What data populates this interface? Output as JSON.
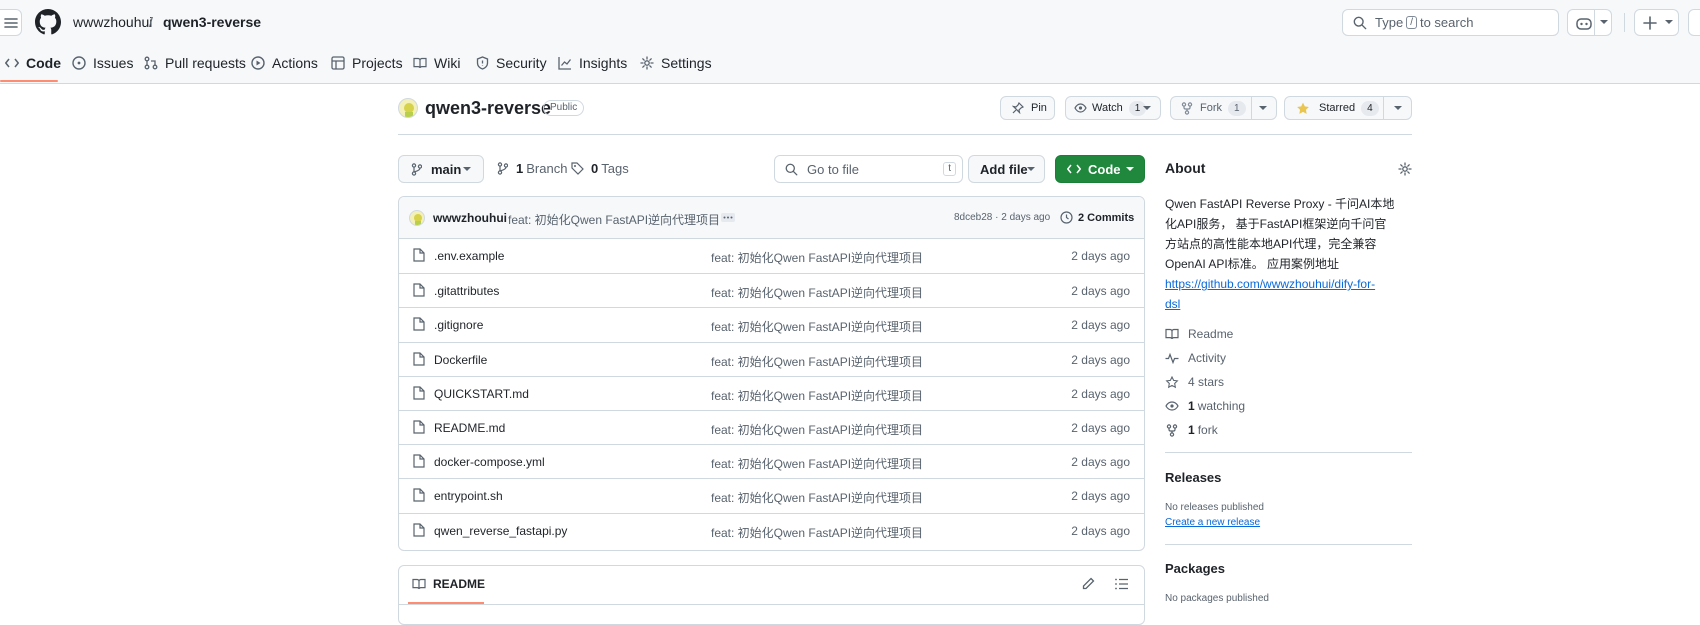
{
  "header": {
    "owner": "wwwzhouhui",
    "separator": "/",
    "repo": "qwen3-reverse",
    "search_prefix": "Type",
    "search_key": "/",
    "search_suffix": "to search"
  },
  "tabs": [
    "Code",
    "Issues",
    "Pull requests",
    "Actions",
    "Projects",
    "Wiki",
    "Security",
    "Insights",
    "Settings"
  ],
  "repo": {
    "name": "qwen3-reverse",
    "visibility": "Public",
    "pin_label": "Pin",
    "watch_label": "Watch",
    "watch_count": "1",
    "fork_label": "Fork",
    "fork_count": "1",
    "star_label": "Starred",
    "star_count": "4"
  },
  "controls": {
    "branch": "main",
    "branches_count": "1",
    "branches_label": "Branch",
    "tags_count": "0",
    "tags_label": "Tags",
    "goto_placeholder": "Go to file",
    "goto_key": "t",
    "add_file": "Add file",
    "code": "Code"
  },
  "commit": {
    "author": "wwwzhouhui",
    "message": "feat: 初始化Qwen FastAPI逆向代理项目",
    "meta": "8dceb28 · 2 days ago",
    "commits": "2 Commits"
  },
  "files": [
    {
      "name": ".env.example",
      "message": "feat: 初始化Qwen FastAPI逆向代理项目",
      "date": "2 days ago"
    },
    {
      "name": ".gitattributes",
      "message": "feat: 初始化Qwen FastAPI逆向代理项目",
      "date": "2 days ago"
    },
    {
      "name": ".gitignore",
      "message": "feat: 初始化Qwen FastAPI逆向代理项目",
      "date": "2 days ago"
    },
    {
      "name": "Dockerfile",
      "message": "feat: 初始化Qwen FastAPI逆向代理项目",
      "date": "2 days ago"
    },
    {
      "name": "QUICKSTART.md",
      "message": "feat: 初始化Qwen FastAPI逆向代理项目",
      "date": "2 days ago"
    },
    {
      "name": "README.md",
      "message": "feat: 初始化Qwen FastAPI逆向代理项目",
      "date": "2 days ago"
    },
    {
      "name": "docker-compose.yml",
      "message": "feat: 初始化Qwen FastAPI逆向代理项目",
      "date": "2 days ago"
    },
    {
      "name": "entrypoint.sh",
      "message": "feat: 初始化Qwen FastAPI逆向代理项目",
      "date": "2 days ago"
    },
    {
      "name": "qwen_reverse_fastapi.py",
      "message": "feat: 初始化Qwen FastAPI逆向代理项目",
      "date": "2 days ago"
    }
  ],
  "readme_tab": "README",
  "about": {
    "title": "About",
    "desc_lines": [
      "Qwen FastAPI Reverse Proxy - 千问AI本地",
      "化API服务， 基于FastAPI框架逆向千问官",
      "方站点的高性能本地API代理，完全兼容",
      "OpenAI API标准。 应用案例地址"
    ],
    "link_lines": [
      "https://github.com/wwwzhouhui/dify-for-",
      "dsl"
    ],
    "readme": "Readme",
    "activity": "Activity",
    "stars": "4 stars",
    "watching_count": "1",
    "watching_label": "watching",
    "forks_count": "1",
    "forks_label": "fork"
  },
  "releases": {
    "title": "Releases",
    "none": "No releases published",
    "create": "Create a new release"
  },
  "packages": {
    "title": "Packages",
    "none": "No packages published"
  },
  "colors": {
    "accent_green": "#1f883d",
    "link_blue": "#0969da",
    "tab_underline": "#fd8c73",
    "star_yellow": "#eac54f"
  }
}
